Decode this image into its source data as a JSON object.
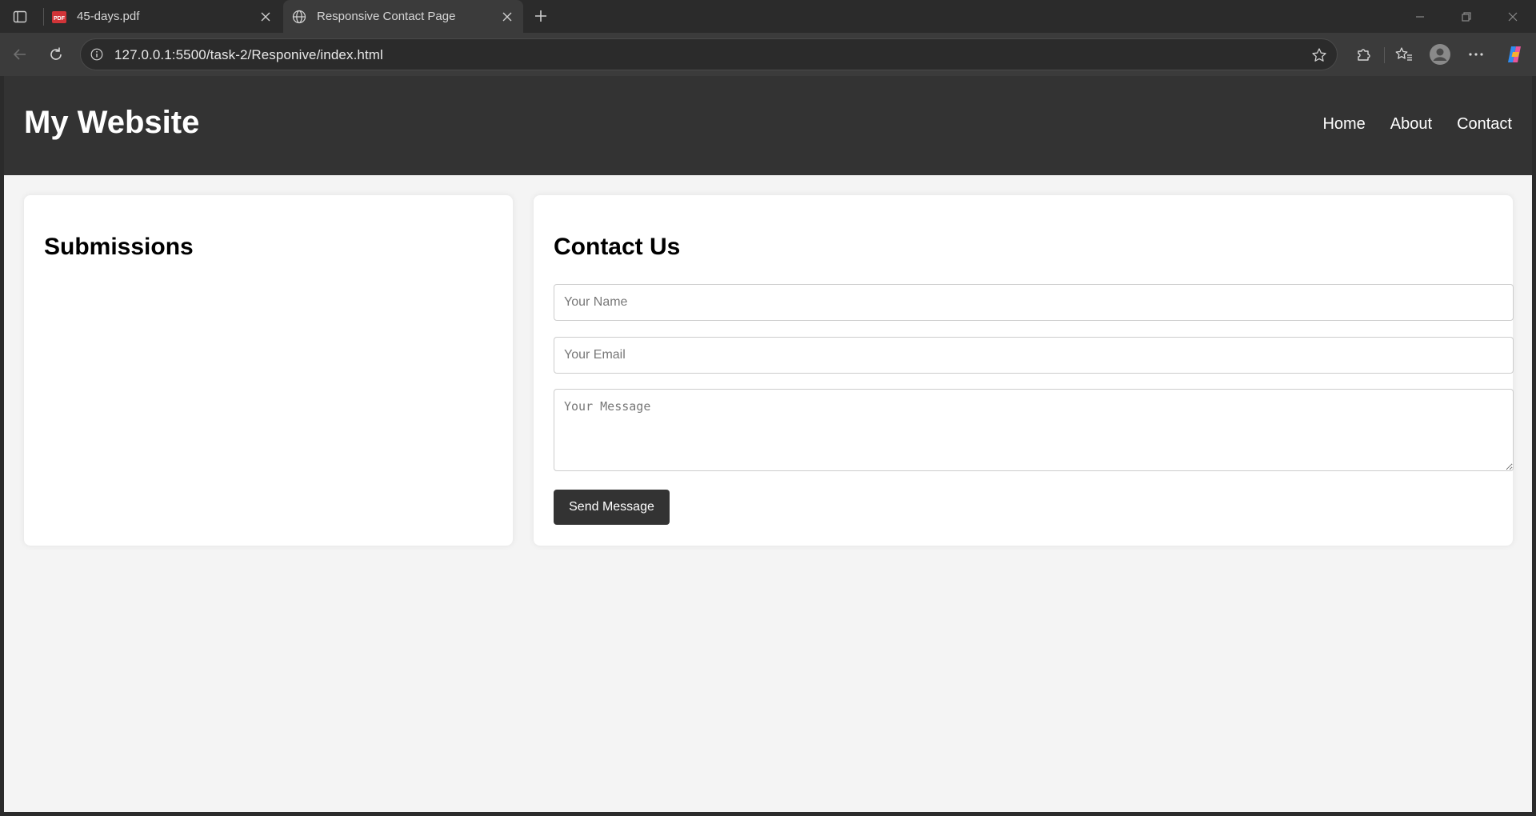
{
  "browser": {
    "tabs": [
      {
        "title": "45-days.pdf",
        "icon": "pdf-icon",
        "active": false
      },
      {
        "title": "Responsive Contact Page",
        "icon": "globe-icon",
        "active": true
      }
    ],
    "url": "127.0.0.1:5500/task-2/Responive/index.html"
  },
  "site": {
    "title": "My Website",
    "nav": [
      "Home",
      "About",
      "Contact"
    ]
  },
  "submissions": {
    "heading": "Submissions"
  },
  "contact": {
    "heading": "Contact Us",
    "name_placeholder": "Your Name",
    "email_placeholder": "Your Email",
    "message_placeholder": "Your Message",
    "send_label": "Send Message"
  },
  "colors": {
    "header_bg": "#333333",
    "page_bg": "#f4f4f4",
    "button_bg": "#333333",
    "chrome_bg": "#2b2b2b"
  }
}
